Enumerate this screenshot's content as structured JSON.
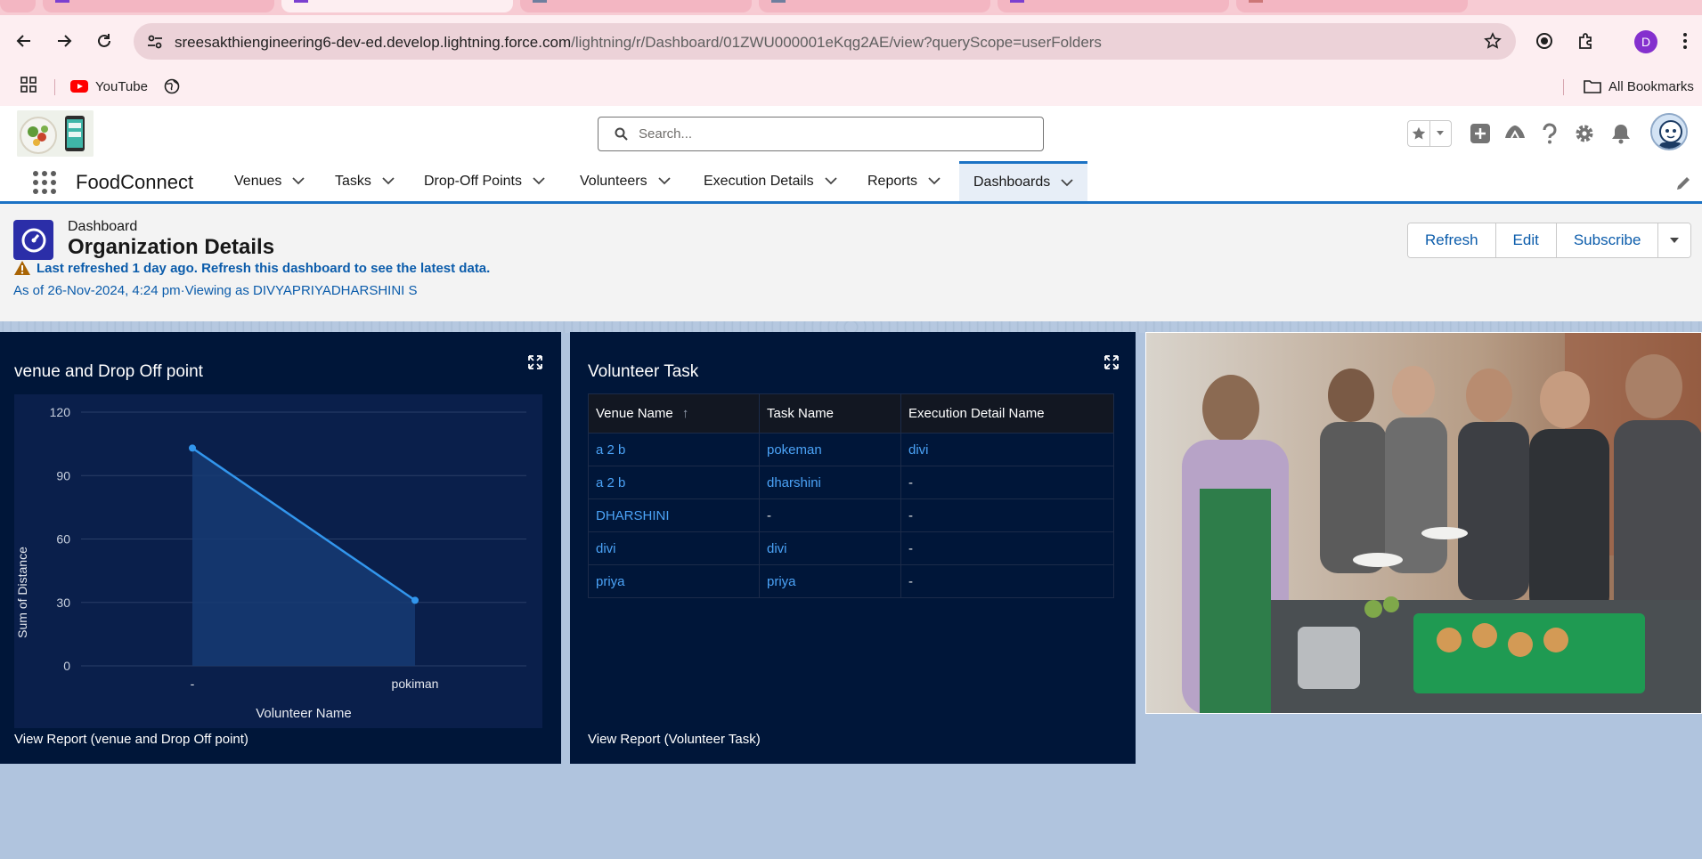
{
  "browser": {
    "url_host": "sreesakthiengineering6-dev-ed.develop.lightning.force.com",
    "url_path": "/lightning/r/Dashboard/01ZWU000001eKqg2AE/view?queryScope=userFolders",
    "profile_initial": "D",
    "bookmarks": [
      {
        "label": "YouTube",
        "icon": "youtube-icon"
      },
      {
        "label": "",
        "icon": "globe-icon"
      }
    ],
    "all_bookmarks_label": "All Bookmarks"
  },
  "header": {
    "search_placeholder": "Search..."
  },
  "appnav": {
    "app_name": "FoodConnect",
    "items": [
      {
        "label": "Venues"
      },
      {
        "label": "Tasks"
      },
      {
        "label": "Drop-Off Points"
      },
      {
        "label": "Volunteers"
      },
      {
        "label": "Execution Details"
      },
      {
        "label": "Reports"
      },
      {
        "label": "Dashboards",
        "active": true
      }
    ]
  },
  "dashboard": {
    "type_label": "Dashboard",
    "title": "Organization Details",
    "warning": "Last refreshed 1 day ago. Refresh this dashboard to see the latest data.",
    "as_of": "As of 26-Nov-2024, 4:24 pm·Viewing as DIVYAPRIYADHARSHINI S",
    "buttons": {
      "refresh": "Refresh",
      "edit": "Edit",
      "subscribe": "Subscribe"
    }
  },
  "widgets": {
    "chart": {
      "title": "venue and Drop Off point",
      "view_report": "View Report (venue and Drop Off point)"
    },
    "table": {
      "title": "Volunteer Task",
      "view_report": "View Report (Volunteer Task)",
      "columns": [
        "Venue Name",
        "Task Name",
        "Execution Detail Name"
      ],
      "rows": [
        [
          "a 2 b",
          "pokeman",
          "divi"
        ],
        [
          "a 2 b",
          "dharshini",
          "-"
        ],
        [
          "DHARSHINI",
          "-",
          "-"
        ],
        [
          "divi",
          "divi",
          "-"
        ],
        [
          "priya",
          "priya",
          "-"
        ]
      ]
    }
  },
  "chart_data": {
    "type": "area",
    "title": "venue and Drop Off point",
    "xlabel": "Volunteer Name",
    "ylabel": "Sum of Distance",
    "categories": [
      "-",
      "pokiman"
    ],
    "series": [
      {
        "values": [
          103,
          31
        ]
      }
    ],
    "yticks": [
      0,
      30,
      60,
      90,
      120
    ],
    "ylim": [
      0,
      120
    ],
    "grid": true,
    "colors": {
      "line": "#3296ed",
      "area": "#163b73"
    }
  }
}
